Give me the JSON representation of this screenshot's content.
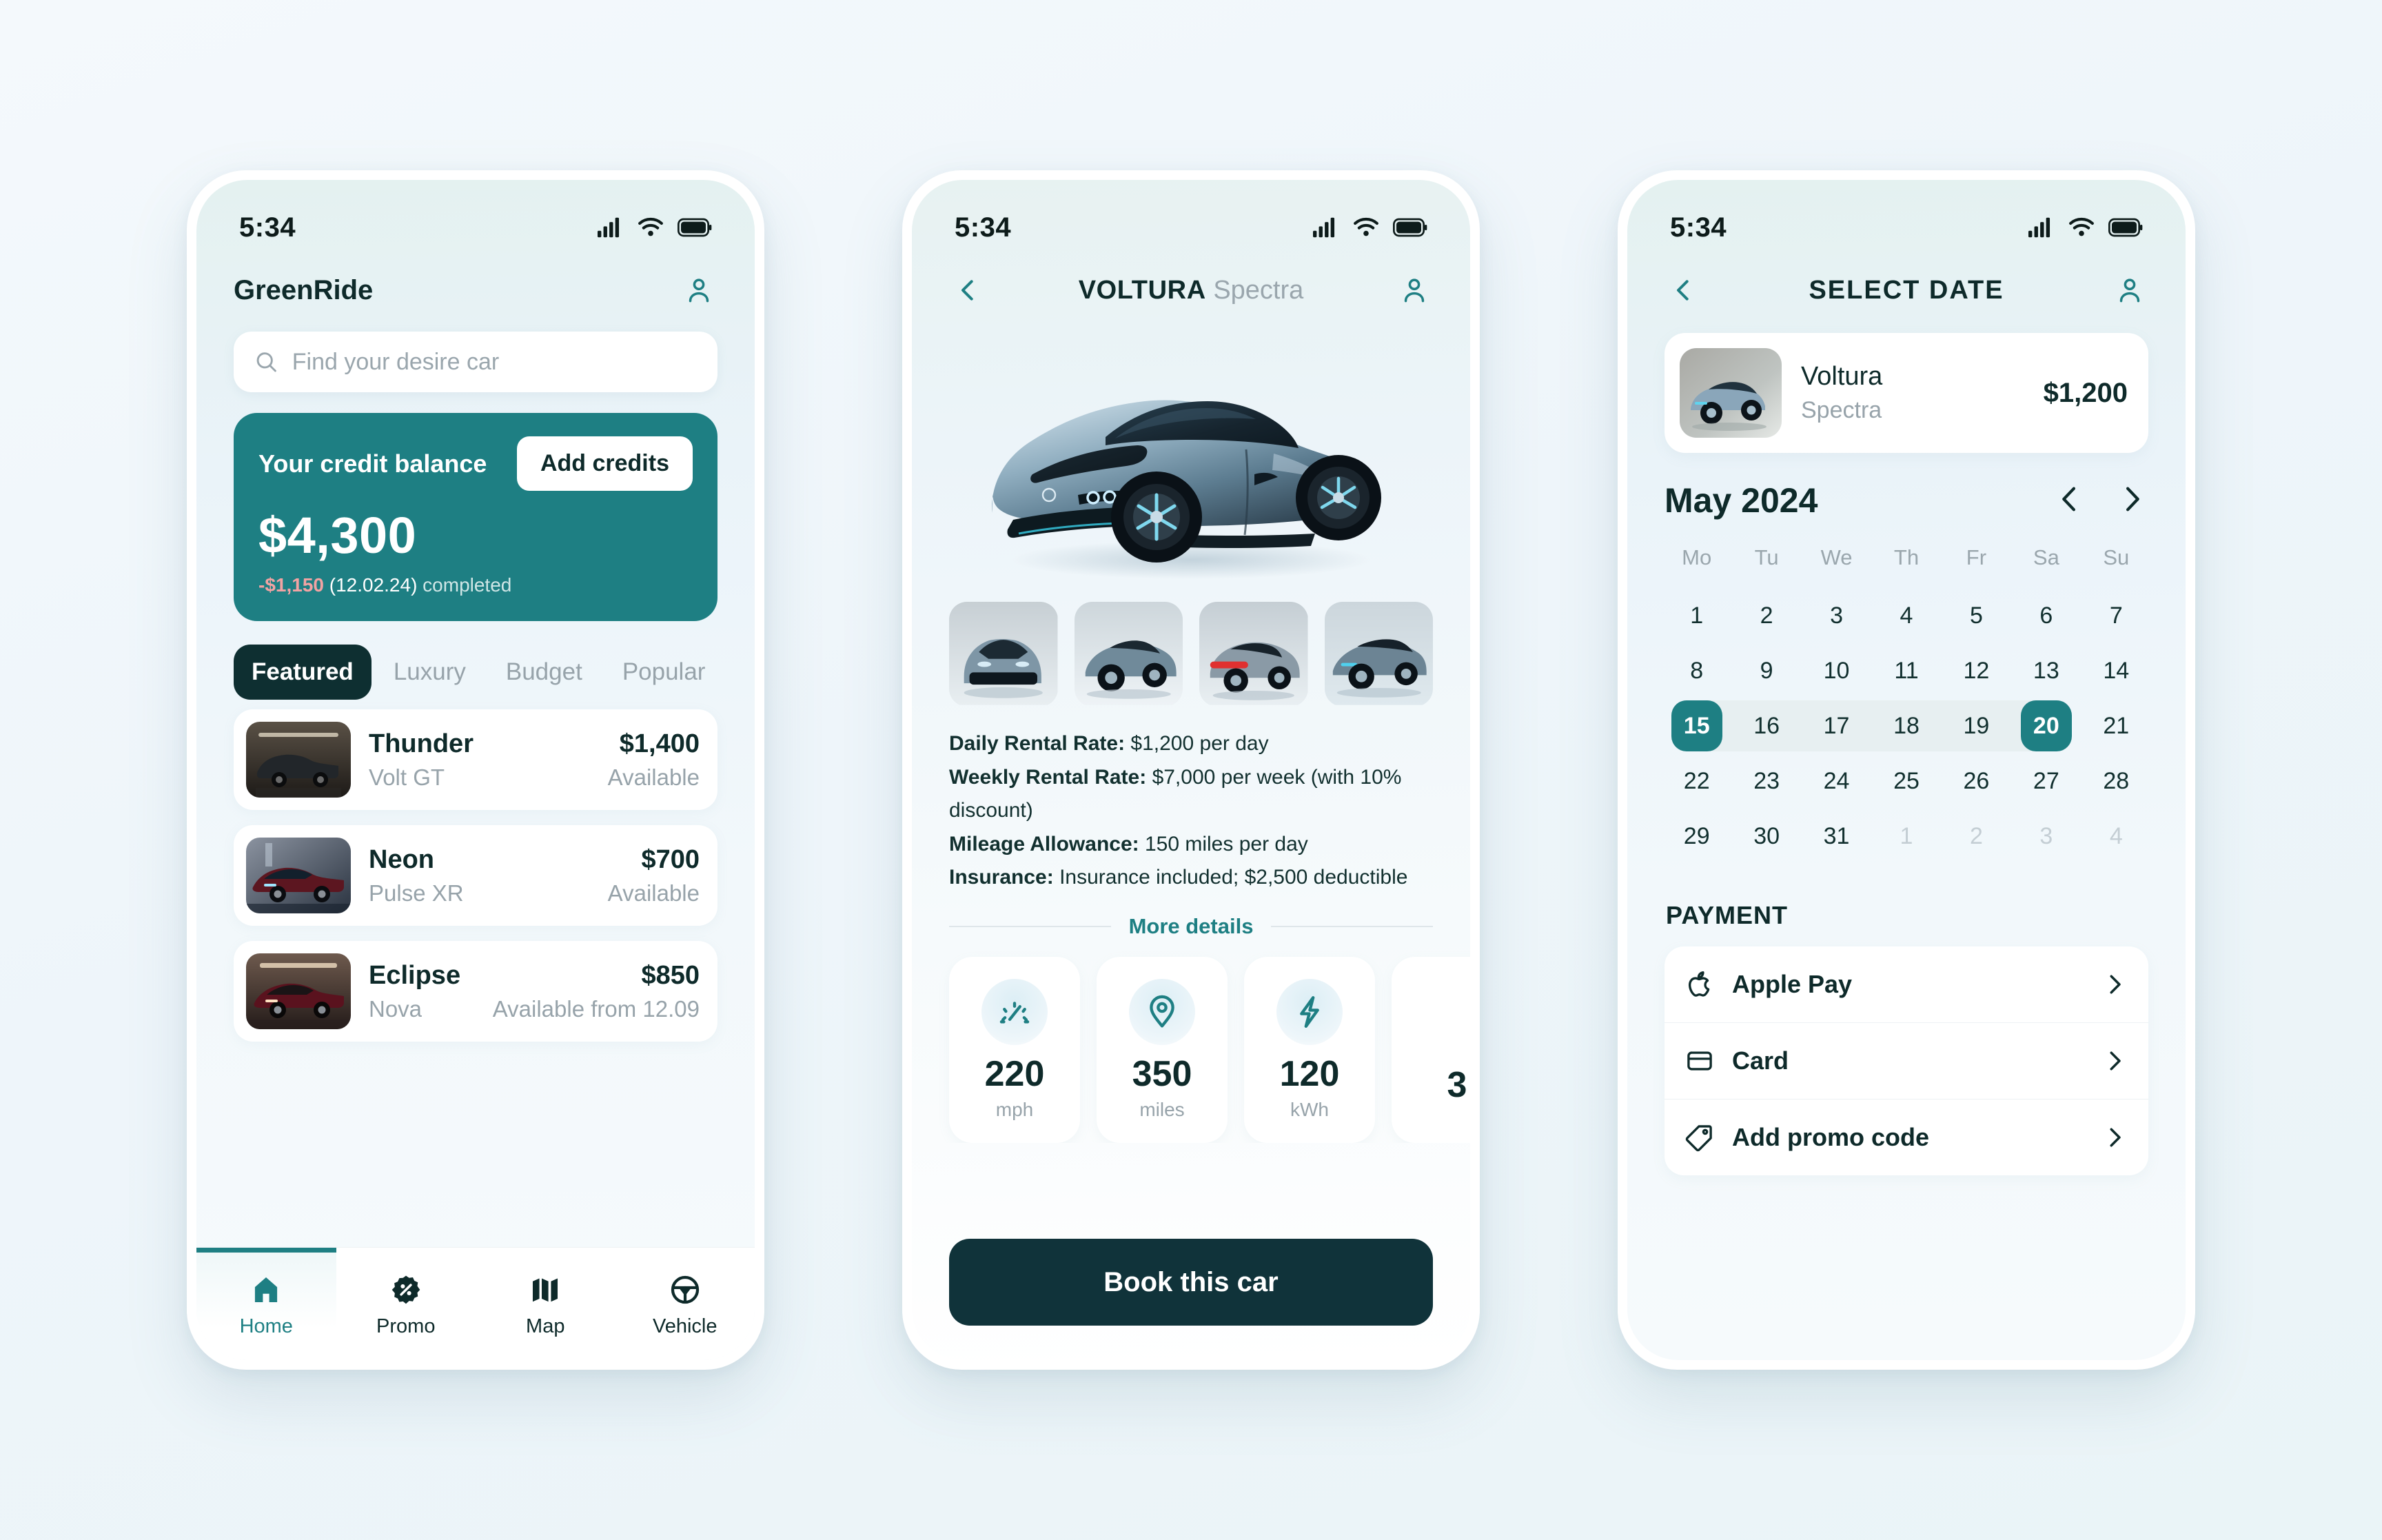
{
  "theme": {
    "teal": "#1e7f83",
    "dark": "#0e2f31",
    "ink": "#0e2a2a",
    "muted": "#97a3aa",
    "page_bg": "#f1f7fb"
  },
  "phone1": {
    "status": {
      "time": "5:34",
      "signal": "signal-bars-icon",
      "wifi": "wifi-icon",
      "battery": "battery-icon"
    },
    "appbar": {
      "brand": "GreenRide",
      "profile_icon": "person-icon"
    },
    "search": {
      "placeholder": "Find your desire car",
      "value": "",
      "icon": "search-icon"
    },
    "credit": {
      "label": "Your credit balance",
      "add_button": "Add credits",
      "amount": "$4,300",
      "txn_amount": "-$1,150",
      "txn_date": "(12.02.24)",
      "txn_status": "completed"
    },
    "tabs": [
      {
        "label": "Featured",
        "active": true
      },
      {
        "label": "Luxury",
        "active": false
      },
      {
        "label": "Budget",
        "active": false
      },
      {
        "label": "Popular",
        "active": false
      }
    ],
    "cars": [
      {
        "name": "Thunder",
        "model": "Volt GT",
        "price": "$1,400",
        "status": "Available"
      },
      {
        "name": "Neon",
        "model": "Pulse XR",
        "price": "$700",
        "status": "Available"
      },
      {
        "name": "Eclipse",
        "model": "Nova",
        "price": "$850",
        "status": "Available from 12.09"
      }
    ],
    "nav": [
      {
        "label": "Home",
        "icon": "home-icon",
        "active": true
      },
      {
        "label": "Promo",
        "icon": "promo-badge-percent-icon",
        "active": false
      },
      {
        "label": "Map",
        "icon": "map-icon",
        "active": false
      },
      {
        "label": "Vehicle",
        "icon": "steering-wheel-icon",
        "active": false
      }
    ]
  },
  "phone2": {
    "status": {
      "time": "5:34"
    },
    "appbar": {
      "back_icon": "chevron-left-icon",
      "title_brand": "VOLTURA",
      "title_model": "Spectra",
      "profile_icon": "person-icon"
    },
    "gallery": [
      "car-front-thumb",
      "car-three-quarter-thumb",
      "car-rear-thumb",
      "car-side-thumb"
    ],
    "details": [
      {
        "label": "Daily Rental Rate:",
        "value": "$1,200 per day"
      },
      {
        "label": "Weekly Rental Rate:",
        "value": "$7,000 per week (with 10% discount)"
      },
      {
        "label": "Mileage Allowance:",
        "value": "150 miles per day"
      },
      {
        "label": "Insurance:",
        "value": "Insurance included; $2,500 deductible"
      }
    ],
    "more_details": "More details",
    "specs": [
      {
        "value": "220",
        "unit": "mph",
        "icon": "speedometer-icon"
      },
      {
        "value": "350",
        "unit": "miles",
        "icon": "location-pin-icon"
      },
      {
        "value": "120",
        "unit": "kWh",
        "icon": "lightning-bolt-icon"
      },
      {
        "value": "3",
        "unit": "",
        "icon": "partial-card-icon"
      }
    ],
    "book_button": "Book this car"
  },
  "phone3": {
    "status": {
      "time": "5:34"
    },
    "appbar": {
      "back_icon": "chevron-left-icon",
      "title": "SELECT DATE",
      "profile_icon": "person-icon"
    },
    "summary": {
      "name": "Voltura",
      "model": "Spectra",
      "price": "$1,200",
      "thumb": "car-thumb"
    },
    "calendar": {
      "month": "May 2024",
      "prev_icon": "chevron-left-icon",
      "next_icon": "chevron-right-icon",
      "dow": [
        "Mo",
        "Tu",
        "We",
        "Th",
        "Fr",
        "Sa",
        "Su"
      ],
      "weeks": [
        [
          {
            "d": "1"
          },
          {
            "d": "2"
          },
          {
            "d": "3"
          },
          {
            "d": "4"
          },
          {
            "d": "5"
          },
          {
            "d": "6"
          },
          {
            "d": "7"
          }
        ],
        [
          {
            "d": "8"
          },
          {
            "d": "9"
          },
          {
            "d": "10"
          },
          {
            "d": "11"
          },
          {
            "d": "12"
          },
          {
            "d": "13"
          },
          {
            "d": "14"
          }
        ],
        [
          {
            "d": "15",
            "state": "rstart"
          },
          {
            "d": "16",
            "state": "inrange"
          },
          {
            "d": "17",
            "state": "inrange"
          },
          {
            "d": "18",
            "state": "inrange"
          },
          {
            "d": "19",
            "state": "inrange"
          },
          {
            "d": "20",
            "state": "rend"
          },
          {
            "d": "21"
          }
        ],
        [
          {
            "d": "22"
          },
          {
            "d": "23"
          },
          {
            "d": "24"
          },
          {
            "d": "25"
          },
          {
            "d": "26"
          },
          {
            "d": "27"
          },
          {
            "d": "28"
          }
        ],
        [
          {
            "d": "29"
          },
          {
            "d": "30"
          },
          {
            "d": "31"
          },
          {
            "d": "1",
            "state": "muted"
          },
          {
            "d": "2",
            "state": "muted"
          },
          {
            "d": "3",
            "state": "muted"
          },
          {
            "d": "4",
            "state": "muted"
          }
        ]
      ],
      "selected_start": "15",
      "selected_end": "20"
    },
    "payment": {
      "title": "PAYMENT",
      "options": [
        {
          "label": "Apple Pay",
          "icon": "apple-icon",
          "chevron": "chevron-right-icon"
        },
        {
          "label": "Card",
          "icon": "credit-card-icon",
          "chevron": "chevron-right-icon"
        },
        {
          "label": "Add promo code",
          "icon": "tag-icon",
          "chevron": "chevron-right-icon"
        }
      ]
    }
  }
}
